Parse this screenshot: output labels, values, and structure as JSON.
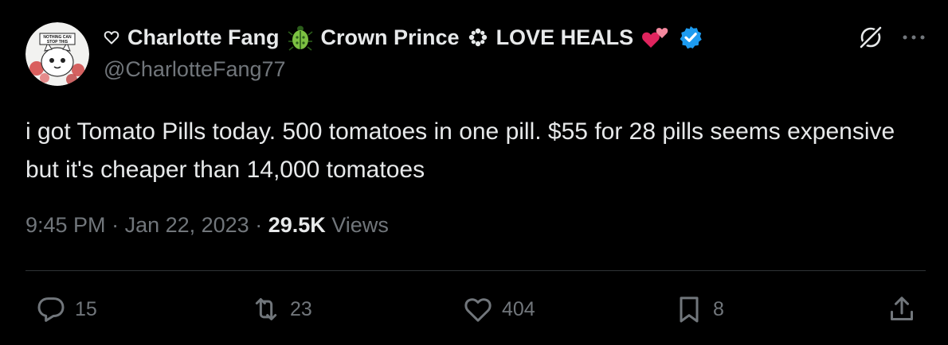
{
  "author": {
    "display_name_parts": [
      "Charlotte Fang",
      "Crown Prince",
      "LOVE HEALS"
    ],
    "handle": "@CharlotteFang77",
    "avatar_text_top": "NOTHING CAN",
    "avatar_text_bottom": "STOP THIS",
    "verified_color": "#1d9bf0"
  },
  "tweet": {
    "text": "i got Tomato Pills today. 500 tomatoes in one pill. $55 for 28 pills seems expensive but it's cheaper than 14,000 tomatoes",
    "time": "9:45 PM",
    "date": "Jan 22, 2023",
    "separator": " · ",
    "views_count": "29.5K",
    "views_label": "Views"
  },
  "stats": {
    "replies": "15",
    "reposts": "23",
    "likes": "404",
    "bookmarks": "8"
  },
  "icons": [
    "heart-outline-icon",
    "beetle-icon",
    "flower-icon",
    "sparkling-hearts-icon",
    "verified-badge-icon",
    "grok-icon",
    "more-icon",
    "reply-icon",
    "repost-icon",
    "like-icon",
    "bookmark-icon",
    "share-icon"
  ],
  "colors": {
    "background": "#000000",
    "text": "#e7e9ea",
    "secondary": "#71767b",
    "divider": "#2f3336"
  }
}
